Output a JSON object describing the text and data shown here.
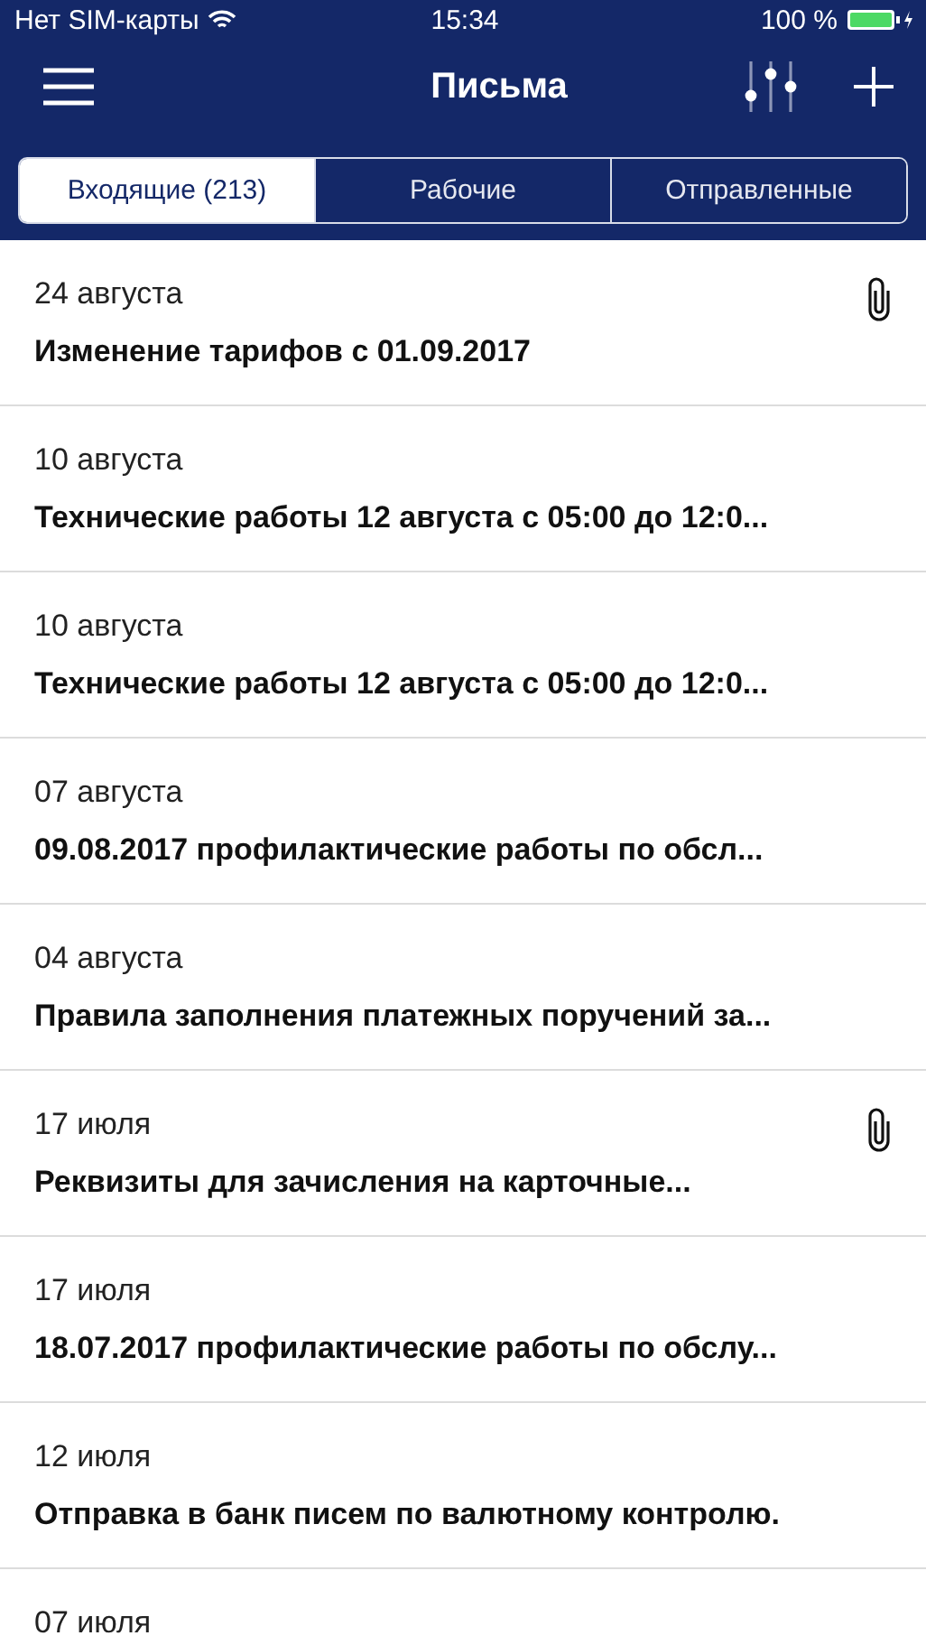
{
  "status_bar": {
    "carrier": "Нет SIM-карты",
    "time": "15:34",
    "battery": "100 %"
  },
  "nav": {
    "title": "Письма"
  },
  "tabs": [
    {
      "label": "Входящие (213)",
      "selected": true
    },
    {
      "label": "Рабочие",
      "selected": false
    },
    {
      "label": "Отправленные",
      "selected": false
    }
  ],
  "messages": [
    {
      "date": "24 августа",
      "subject": "Изменение тарифов с 01.09.2017",
      "attachment": true
    },
    {
      "date": "10 августа",
      "subject": "Технические работы 12 августа с 05:00 до 12:0...",
      "attachment": false
    },
    {
      "date": "10 августа",
      "subject": "Технические работы 12 августа с 05:00 до 12:0...",
      "attachment": false
    },
    {
      "date": "07 августа",
      "subject": "09.08.2017 профилактические работы по обсл...",
      "attachment": false
    },
    {
      "date": "04 августа",
      "subject": "Правила заполнения платежных поручений за...",
      "attachment": false
    },
    {
      "date": "17 июля",
      "subject": "Реквизиты для зачисления на карточные...",
      "attachment": true
    },
    {
      "date": "17 июля",
      "subject": "18.07.2017 профилактические работы по обслу...",
      "attachment": false
    },
    {
      "date": "12 июля",
      "subject": "Отправка в банк писем по валютному контролю.",
      "attachment": false
    },
    {
      "date": "07 июля"
    }
  ]
}
